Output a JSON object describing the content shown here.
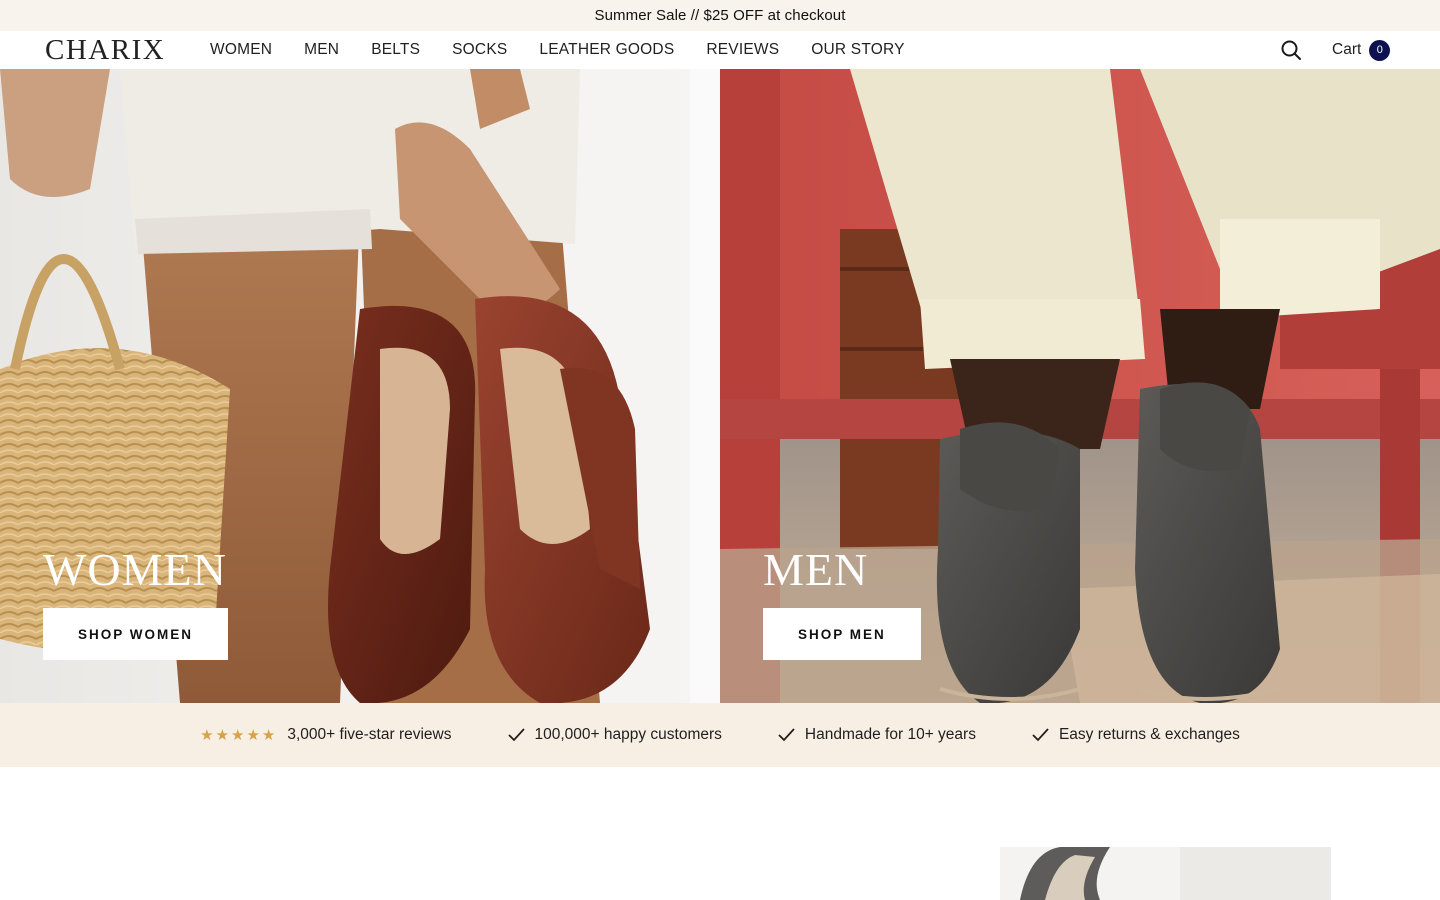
{
  "announcement": {
    "text": "Summer Sale // $25 OFF at checkout"
  },
  "header": {
    "logo": "CHARIX",
    "nav": [
      "WOMEN",
      "MEN",
      "BELTS",
      "SOCKS",
      "LEATHER GOODS",
      "REVIEWS",
      "OUR STORY"
    ],
    "search_icon": "search-icon",
    "cart_label": "Cart",
    "cart_count": "0"
  },
  "hero": {
    "women": {
      "title": "WOMEN",
      "button": "SHOP WOMEN"
    },
    "men": {
      "title": "MEN",
      "button": "SHOP MEN"
    }
  },
  "trust": {
    "rating_stars": 5,
    "items": [
      "3,000+ five-star reviews",
      "100,000+ happy customers",
      "Handmade for 10+ years",
      "Easy returns & exchanges"
    ]
  },
  "colors": {
    "announcement_bg": "#f8f3ec",
    "trust_bg": "#f8efe4",
    "cart_badge": "#0d1150",
    "star": "#d6a24a"
  }
}
